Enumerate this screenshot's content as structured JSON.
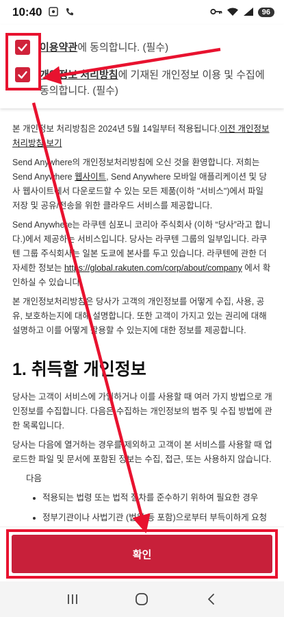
{
  "status_bar": {
    "time": "10:40",
    "icons_left": [
      "screenshot-icon",
      "call-icon"
    ],
    "icons_right": [
      "vpn-key-icon",
      "wifi-icon",
      "signal-icon"
    ],
    "battery": "96"
  },
  "consent": {
    "item1": {
      "checked": true,
      "link": "이용약관",
      "text": "에 동의합니다. (필수)"
    },
    "item2": {
      "checked": true,
      "link": "개인정보 처리방침",
      "text": "에 기재된 개인정보 이용 및 수집에 동의합니다. (필수)"
    }
  },
  "policy": {
    "intro_text": "본 개인정보 처리방침은 2024년 5월 14일부터 적용됩니다.",
    "prev_link": "이전 개인정보 처리방침 보기",
    "p1": "Send Anywhere의 개인정보처리방침에 오신 것을 환영합니다. 저희는 Send Anywhere ",
    "p1_link": "웹사이트",
    "p1_rest": ", Send Anywhere 모바일 애플리케이션 및 당사 웹사이트에서 다운로드할 수 있는 모든 제품(이하 \"서비스\")에서 파일 저장 및 공유/전송을 위한 클라우드 서비스를 제공합니다.",
    "p2": "Send Anywhere는 라쿠텐 심포니 코리아 주식회사 (이하 “당사”라고 합니다.)에서 제공하는 서비스입니다. 당사는 라쿠텐 그룹의 일부입니다. 라쿠텐 그룹 주식회사는 일본 도쿄에 본사를 두고 있습니다. 라쿠텐에 관한 더 자세한 정보는 ",
    "p2_link": "https://global.rakuten.com/corp/about/company",
    "p2_rest": " 에서 확인하실 수 있습니다.",
    "p3": "본 개인정보처리방침은 당사가 고객의 개인정보를 어떻게 수집, 사용, 공유, 보호하는지에 대해 설명합니다. 또한 고객이 가지고 있는 권리에 대해 설명하고 이를 어떻게 활용할 수 있는지에 대한 정보를 제공합니다.",
    "section1_title": "1. 취득할 개인정보",
    "p4": "당사는 고객이 서비스에 가입하거나 이를 사용할 때 여러 가지 방법으로 개인정보를 수집합니다. 다음은 수집하는 개인정보의 범주 및 수집 방법에 관한 목록입니다.",
    "p5": "당사는 다음에 열거하는 경우를 제외하고 고객이 본 서비스를 사용할 때 업로드한 파일 및 문서에 포함된 정보는 수집, 접근, 또는 사용하지 않습니다.",
    "p6": "다음",
    "bullets": [
      "적용되는 법령 또는 법적 절차를 준수하기 위하여 필요한 경우",
      "정부기관이나 사법기관 (법원 등 포함)으로부터 부득이하게 요청을 받은 경우"
    ]
  },
  "footer": {
    "confirm_label": "확인"
  },
  "nav": {
    "buttons": [
      "recent-apps-icon",
      "home-icon",
      "back-icon"
    ]
  },
  "colors": {
    "accent": "#c8203a",
    "annotation": "#e8122f"
  }
}
